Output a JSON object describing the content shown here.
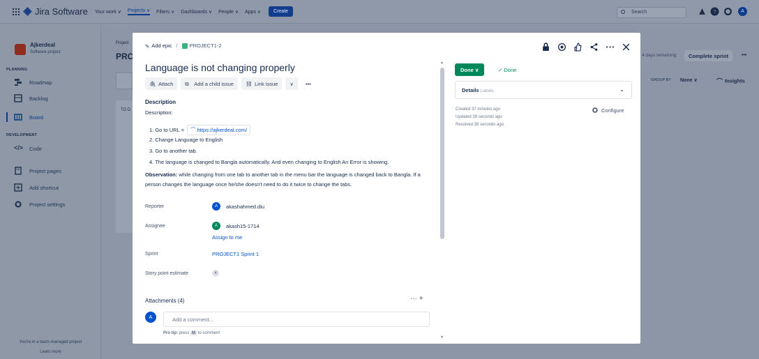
{
  "topnav": {
    "brand": "Jira Software",
    "items": [
      "Your work ∨",
      "Projects ∨",
      "Filters ∨",
      "Dashboards ∨",
      "People ∨",
      "Apps ∨"
    ],
    "create_label": "Create",
    "search_placeholder": "Search",
    "user_initial": "A"
  },
  "sidebar": {
    "project_name": "Ajkerdeal",
    "project_type": "Software project",
    "planning_label": "PLANNING",
    "roadmap": "Roadmap",
    "backlog": "Backlog",
    "board": "Board",
    "development_label": "DEVELOPMENT",
    "code": "Code",
    "project_pages": "Project pages",
    "add_shortcut": "Add shortcut",
    "project_settings": "Project settings",
    "footer_line1": "You're in a team-managed project",
    "footer_line2": "Learn more"
  },
  "board_bg": {
    "project_crumb": "Project",
    "project_heading": "PRC",
    "column_todo": "TO D",
    "days_remaining": "4 days remaining",
    "complete_sprint": "Complete sprint",
    "more": "•••",
    "group_by": "GROUP BY",
    "group_none": "None ∨",
    "insights": "Insights"
  },
  "modal": {
    "add_epic": "Add epic",
    "crumb_sep": "/",
    "issue_key": "PROJECT1-2",
    "title": "Language is not changing properly",
    "actions": {
      "attach": "Attach",
      "add_child": "Add a child issue",
      "link_issue": "Link issue",
      "dropdown": "∨",
      "more": "•••"
    },
    "description_label": "Description",
    "description_line": "Description:",
    "steps": {
      "s1_prefix": "1. Go to URL = ",
      "s1_url": "https://ajkerdeal.com/",
      "s2": "2. Change Language to English",
      "s3": "3. Go to another tab.",
      "s4": "4. The language is changed to Bangla automatically. And even changing to English An Error is showing."
    },
    "observation_label": "Observation:",
    "observation_text": " while changing from one tab to another tab in the menu bar the language is changed back to Bangla. If a person changes the language once he/she doesn't need to do it twice to change the tabs.",
    "fields": {
      "reporter_label": "Reporter",
      "reporter_initial": "A",
      "reporter_name": "akashahmed.diu",
      "assignee_label": "Assignee",
      "assignee_initial": "A",
      "assignee_name": "akash15-1714",
      "assign_to_me": "Assign to me",
      "sprint_label": "Sprint",
      "sprint_value": "PROJECT1 Sprint 1",
      "story_label": "Story point estimate",
      "story_value": "4"
    },
    "attachments_label": "Attachments (4)",
    "attachments_actions": "··· +",
    "comment_initial": "A",
    "comment_placeholder": "Add a comment...",
    "protip_prefix": "Pro tip:",
    "protip_mid": " press ",
    "protip_key": "M",
    "protip_suffix": " to comment",
    "status_button": "Done ∨",
    "status_text": "✓ Done",
    "details_label": "Details",
    "details_sub": "Labels",
    "created": "Created 37 minutes ago",
    "updated": "Updated 38 seconds ago",
    "resolved": "Resolved 38 seconds ago",
    "configure": "Configure",
    "header_icons": [
      "lock-icon",
      "watch-icon",
      "like-icon",
      "share-icon",
      "more-icon",
      "close-icon"
    ]
  },
  "colors": {
    "accent": "#0052cc",
    "done": "#00875a",
    "create": "#123d8c"
  }
}
